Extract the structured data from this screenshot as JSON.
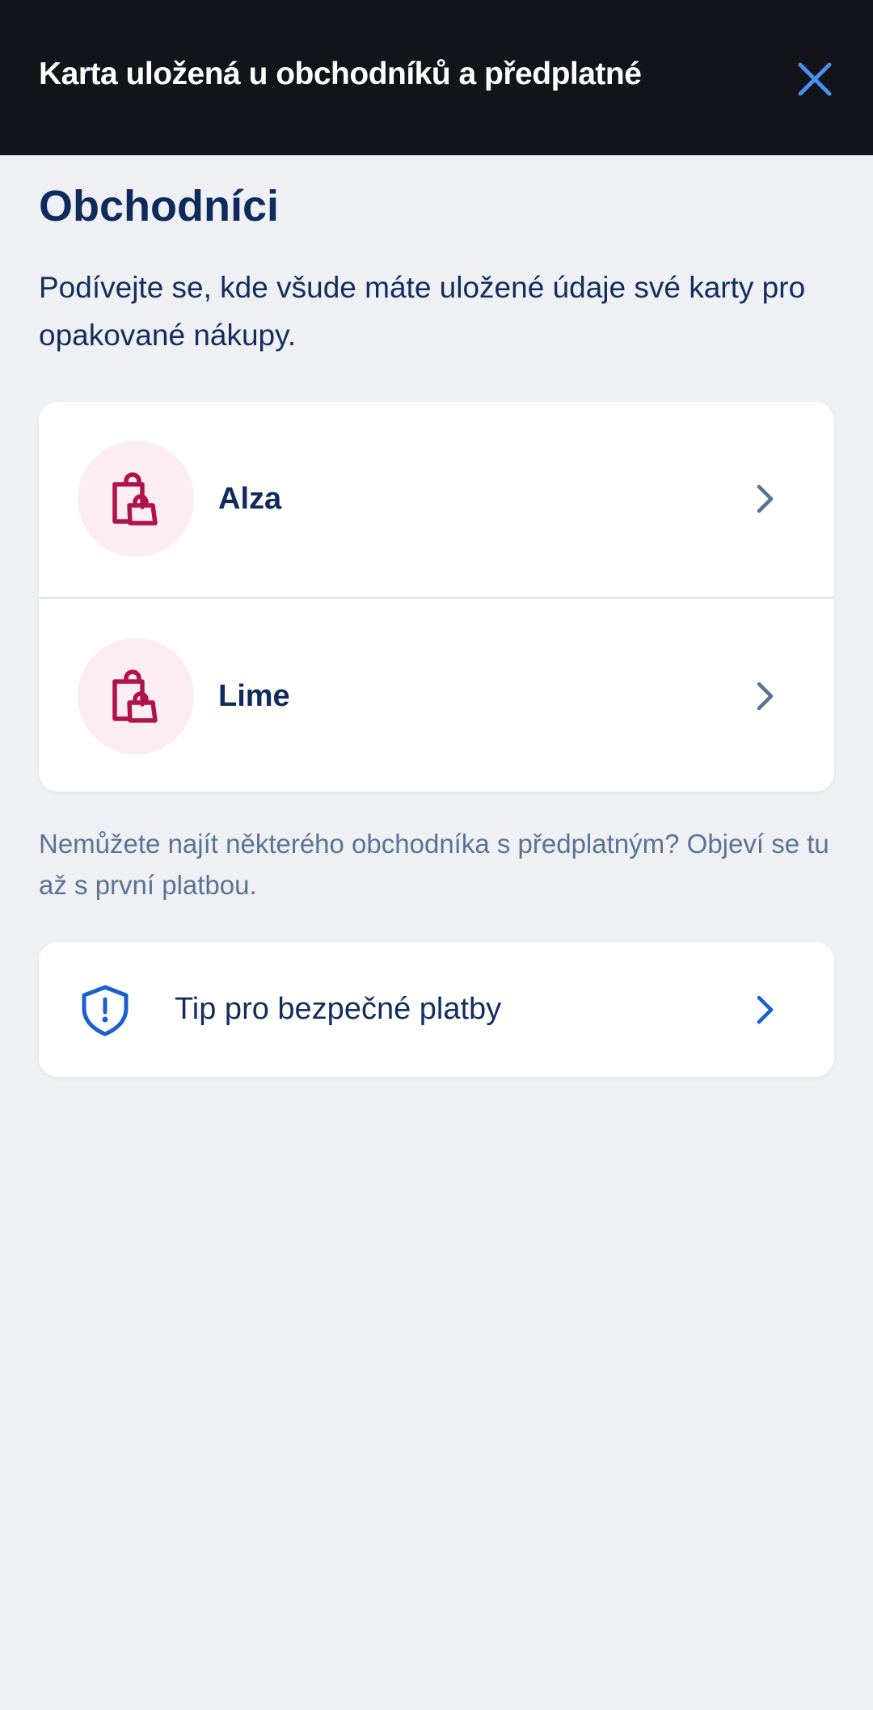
{
  "header": {
    "title": "Karta uložená u obchodníků a předplatné",
    "close_icon": "close-icon",
    "accent_color": "#4a8ff0",
    "background_color": "#131419"
  },
  "main": {
    "title": "Obchodníci",
    "intro": "Podívejte se, kde všude máte uložené údaje své karty pro opakované nákupy.",
    "merchants": [
      {
        "name": "Alza",
        "icon": "shopping-bags-icon"
      },
      {
        "name": "Lime",
        "icon": "shopping-bags-icon"
      }
    ],
    "merchant_icon_color": "#b0124e",
    "merchant_icon_bg": "#fcedf3",
    "note": "Nemůžete najít některého obchodníka s předplatným? Objeví se tu až s první platbou.",
    "tip": {
      "label": "Tip pro bezpečné platby",
      "icon": "shield-alert-icon",
      "icon_color": "#1a5fd0"
    }
  }
}
